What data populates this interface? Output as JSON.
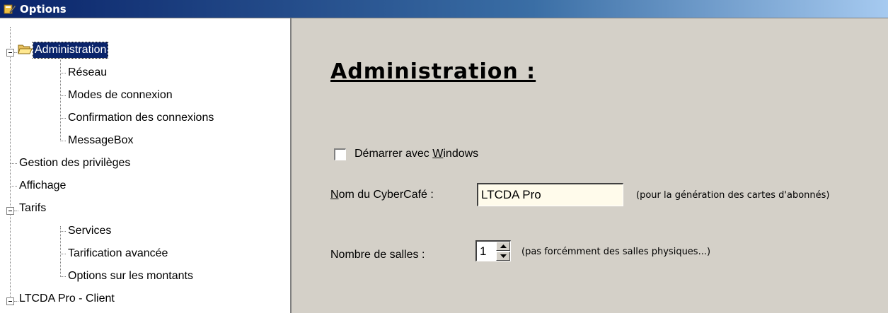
{
  "window": {
    "title": "Options"
  },
  "tree": {
    "items": [
      {
        "label": "Administration",
        "selected": true
      },
      {
        "label": "Réseau"
      },
      {
        "label": "Modes de connexion"
      },
      {
        "label": "Confirmation des connexions"
      },
      {
        "label": "MessageBox"
      },
      {
        "label": "Gestion des privilèges"
      },
      {
        "label": "Affichage"
      },
      {
        "label": "Tarifs"
      },
      {
        "label": "Services"
      },
      {
        "label": "Tarification avancée"
      },
      {
        "label": "Options sur les montants"
      },
      {
        "label": "LTCDA Pro - Client"
      }
    ]
  },
  "panel": {
    "heading": "Administration :",
    "start_with_windows": {
      "prefix": "Démarrer avec ",
      "hotkey": "W",
      "suffix": "indows",
      "checked": false
    },
    "cafe_name": {
      "hotkey": "N",
      "label_rest": "om du CyberCafé :",
      "value": "LTCDA Pro",
      "note": "(pour la génération des cartes d'abonnés)"
    },
    "rooms": {
      "label": "Nombre de salles :",
      "value": "1",
      "note": "(pas forcémment des salles physiques...)"
    }
  },
  "colors": {
    "title_bar": "#0a246a",
    "selection": "#0a246a",
    "dialog_bg": "#d4d0c8",
    "input_bg": "#fffbeb"
  }
}
